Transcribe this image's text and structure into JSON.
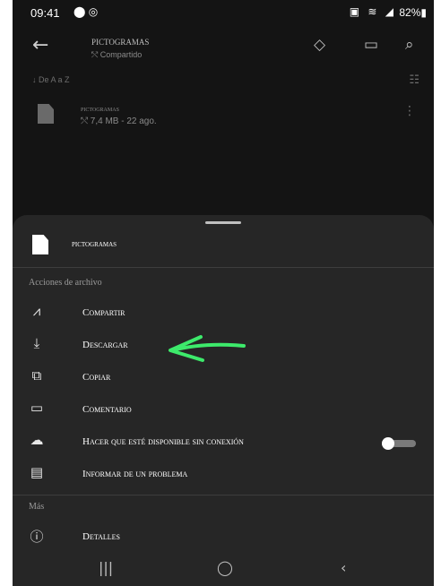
{
  "status_bar": {
    "time": "09:41",
    "app_icons": "⬤ ◎",
    "right_icons": "▣ ≋ ◢",
    "battery": "82%▮"
  },
  "app_bar": {
    "back_icon": "←",
    "title": "pictogramas",
    "subtitle": "⤲ Compartido",
    "actions": [
      "◇",
      "▭",
      "⌕"
    ]
  },
  "sort_row": {
    "label": "↓ De A a Z",
    "grid_icon": "☷"
  },
  "file_row": {
    "name": "pictogramas",
    "meta": "⤲ 7,4 MB - 22 ago.",
    "more_icon": "⋮"
  },
  "sheet": {
    "file_name": "pictogramas",
    "section_actions": "Acciones de archivo",
    "actions": [
      {
        "icon": "⩘",
        "label": "Compartir"
      },
      {
        "icon": "⤓",
        "label": "Descargar"
      },
      {
        "icon": "⧉",
        "label": "Copiar"
      },
      {
        "icon": "▭",
        "label": "Comentario"
      },
      {
        "icon": "☁",
        "label": "Hacer que esté disponible sin conexión"
      },
      {
        "icon": "▤",
        "label": "Informar de un problema"
      }
    ],
    "offline_toggle": "off",
    "section_more": "Más",
    "details": {
      "icon": "ⓘ",
      "label": "Detalles"
    }
  },
  "nav_bar": {
    "recents": "|||",
    "home": "◯",
    "back": "‹"
  },
  "annotation": {
    "color": "#3dea6b",
    "shape": "arrow pointing left at Descargar"
  }
}
